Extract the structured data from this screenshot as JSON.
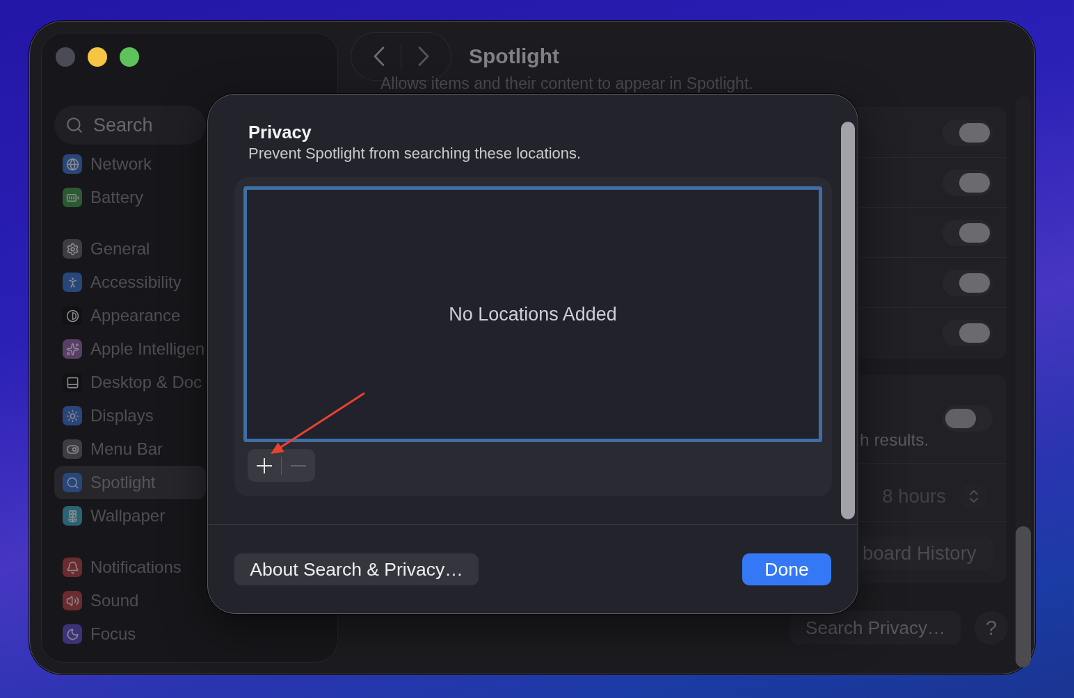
{
  "window": {
    "controls": [
      {
        "kind": "close",
        "disabled": true
      },
      {
        "kind": "minimize",
        "disabled": false
      },
      {
        "kind": "zoom",
        "disabled": false
      }
    ]
  },
  "sidebar": {
    "search": {
      "placeholder": "Search"
    },
    "groups": [
      {
        "items": [
          {
            "label": "Network",
            "color": "#28467a",
            "selected": false
          },
          {
            "label": "Battery",
            "color": "#2c5932",
            "selected": false
          }
        ]
      },
      {
        "items": [
          {
            "label": "General",
            "color": "#3d3d42",
            "selected": false
          },
          {
            "label": "Accessibility",
            "color": "#28467a",
            "selected": false
          },
          {
            "label": "Appearance",
            "color": "#121215",
            "selected": false
          },
          {
            "label": "Apple Intelligen",
            "color": "#5a3e66",
            "selected": false
          },
          {
            "label": "Desktop & Doc",
            "color": "#121215",
            "selected": false
          },
          {
            "label": "Displays",
            "color": "#28467a",
            "selected": false
          },
          {
            "label": "Menu Bar",
            "color": "#3d3d42",
            "selected": false
          },
          {
            "label": "Spotlight",
            "color": "#28467a",
            "selected": true
          },
          {
            "label": "Wallpaper",
            "color": "#2a6474",
            "selected": false
          }
        ]
      },
      {
        "items": [
          {
            "label": "Notifications",
            "color": "#6b2b2f",
            "selected": false
          },
          {
            "label": "Sound",
            "color": "#6b2b2f",
            "selected": false
          },
          {
            "label": "Focus",
            "color": "#3b3378",
            "selected": false
          }
        ]
      }
    ]
  },
  "toolbar": {
    "title": "Spotlight"
  },
  "content": {
    "description": "Allows items and their content to appear in Spotlight.",
    "toggles": [
      {
        "on": true
      },
      {
        "on": true
      },
      {
        "on": true
      },
      {
        "on": true
      },
      {
        "on": true
      }
    ],
    "section": {
      "toggle": {
        "on": false
      },
      "caption": "h results.",
      "popup": {
        "value": "8 hours"
      },
      "button": "board History"
    },
    "footer_buttons": [
      {
        "kind": "text",
        "label": "Search Privacy…"
      },
      {
        "kind": "help",
        "label": "?"
      }
    ]
  },
  "dialog": {
    "title": "Privacy",
    "subtitle": "Prevent Spotlight from searching these locations.",
    "list": {
      "focused": true,
      "empty_text": "No Locations Added"
    },
    "list_buttons": [
      {
        "kind": "add",
        "disabled": false
      },
      {
        "kind": "remove",
        "disabled": true
      }
    ],
    "buttons": [
      {
        "label": "About Search & Privacy…",
        "default": false
      },
      {
        "label": "Done",
        "default": true
      }
    ]
  }
}
